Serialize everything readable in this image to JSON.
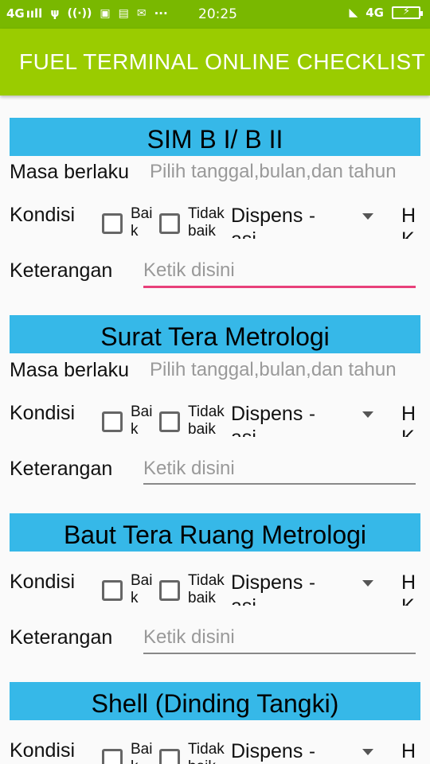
{
  "status_bar": {
    "network_left": "4G",
    "signal_left": "ııll",
    "icons_left": [
      "usb-icon",
      "hotspot-icon",
      "app-icon-1",
      "app-icon-2",
      "mail-icon"
    ],
    "more": "···",
    "time": "20:25",
    "network_right": "4G",
    "battery": "charging"
  },
  "app_bar": {
    "title": "FUEL TERMINAL ONLINE CHECKLIST"
  },
  "sections": [
    {
      "title": "SIM B I/ B II",
      "masa_label": "Masa berlaku",
      "masa_placeholder": "Pilih tanggal,bulan,dan tahun",
      "kondisi_label": "Kondisi",
      "baik": "Baik",
      "tidak_baik": "Tidak baik",
      "dispensasi": "Dispensasi",
      "spinner_value": "-",
      "hk": "HK",
      "keterangan_label": "Keterangan",
      "keterangan_placeholder": "Ketik disini"
    },
    {
      "title": "Surat Tera Metrologi",
      "masa_label": "Masa berlaku",
      "masa_placeholder": "Pilih tanggal,bulan,dan tahun",
      "kondisi_label": "Kondisi",
      "baik": "Baik",
      "tidak_baik": "Tidak baik",
      "dispensasi": "Dispensasi",
      "spinner_value": "-",
      "hk": "HK",
      "keterangan_label": "Keterangan",
      "keterangan_placeholder": "Ketik disini"
    },
    {
      "title": "Baut Tera Ruang Metrologi",
      "kondisi_label": "Kondisi",
      "baik": "Baik",
      "tidak_baik": "Tidak baik",
      "dispensasi": "Dispensasi",
      "spinner_value": "-",
      "hk": "HK",
      "keterangan_label": "Keterangan",
      "keterangan_placeholder": "Ketik disini"
    },
    {
      "title": "Shell (Dinding Tangki)",
      "kondisi_label": "Kondisi",
      "baik": "Baik",
      "tidak_baik": "Tidak baik",
      "dispensasi": "Dispensasi",
      "spinner_value": "-",
      "hk": "HK"
    }
  ]
}
